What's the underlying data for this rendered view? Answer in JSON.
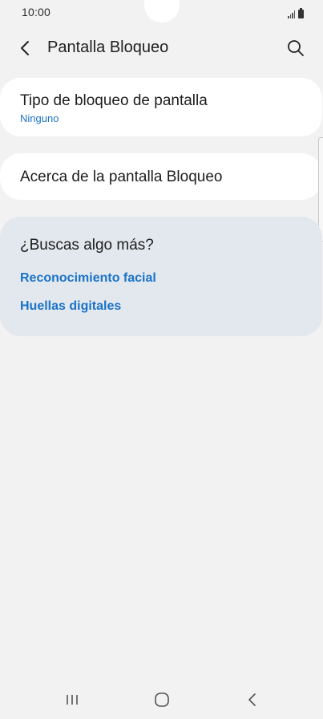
{
  "status_bar": {
    "time": "10:00"
  },
  "header": {
    "title": "Pantalla Bloqueo",
    "back_icon": "chevron-left-icon",
    "search_icon": "search-icon"
  },
  "settings": {
    "screen_lock_type": {
      "title": "Tipo de bloqueo de pantalla",
      "value": "Ninguno"
    },
    "about_lock_screen": {
      "title": "Acerca de la pantalla Bloqueo"
    }
  },
  "suggestions": {
    "title": "¿Buscas algo más?",
    "links": [
      "Reconocimiento facial",
      "Huellas digitales"
    ]
  },
  "navigation": {
    "icons": [
      "recents-icon",
      "home-icon",
      "back-icon"
    ]
  },
  "colors": {
    "accent": "#1a73c8",
    "background": "#f2f2f2",
    "card": "#ffffff",
    "suggestions_background": "#e3e8ee"
  }
}
